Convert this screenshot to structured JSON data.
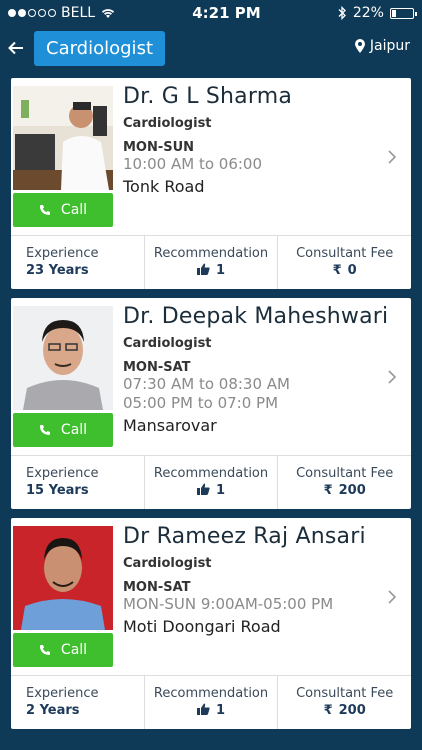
{
  "status_bar": {
    "carrier": "BELL",
    "time": "4:21 PM",
    "battery": "22%",
    "battery_level": 0.22
  },
  "header": {
    "title": "Cardiologist",
    "location": "Jaipur"
  },
  "call_label": "Call",
  "stat_labels": {
    "experience": "Experience",
    "recommendation": "Recommendation",
    "fee": "Consultant Fee"
  },
  "doctors": [
    {
      "name": "Dr. G L Sharma",
      "specialty": "Cardiologist",
      "days": "MON-SUN",
      "time1": "10:00 AM to 06:00",
      "time2": "",
      "address": "Tonk Road",
      "experience": "23 Years",
      "recommendation": "1",
      "fee": "0"
    },
    {
      "name": "Dr. Deepak Maheshwari",
      "specialty": "Cardiologist",
      "days": "MON-SAT",
      "time1": "07:30 AM to 08:30 AM",
      "time2": "05:00 PM to 07:0 PM",
      "address": "Mansarovar",
      "experience": "15 Years",
      "recommendation": "1",
      "fee": "200"
    },
    {
      "name": "Dr Rameez Raj Ansari",
      "specialty": "Cardiologist",
      "days": "MON-SAT",
      "time1": "MON-SUN 9:00AM-05:00 PM",
      "time2": "",
      "address": "Moti Doongari Road",
      "experience": "2 Years",
      "recommendation": "1",
      "fee": "200"
    }
  ],
  "currency_symbol": "₹",
  "icons": {
    "back": "arrow-left-icon",
    "location": "location-pin-icon",
    "phone": "phone-icon",
    "thumb": "thumbs-up-icon",
    "chevron": "chevron-right-icon"
  }
}
